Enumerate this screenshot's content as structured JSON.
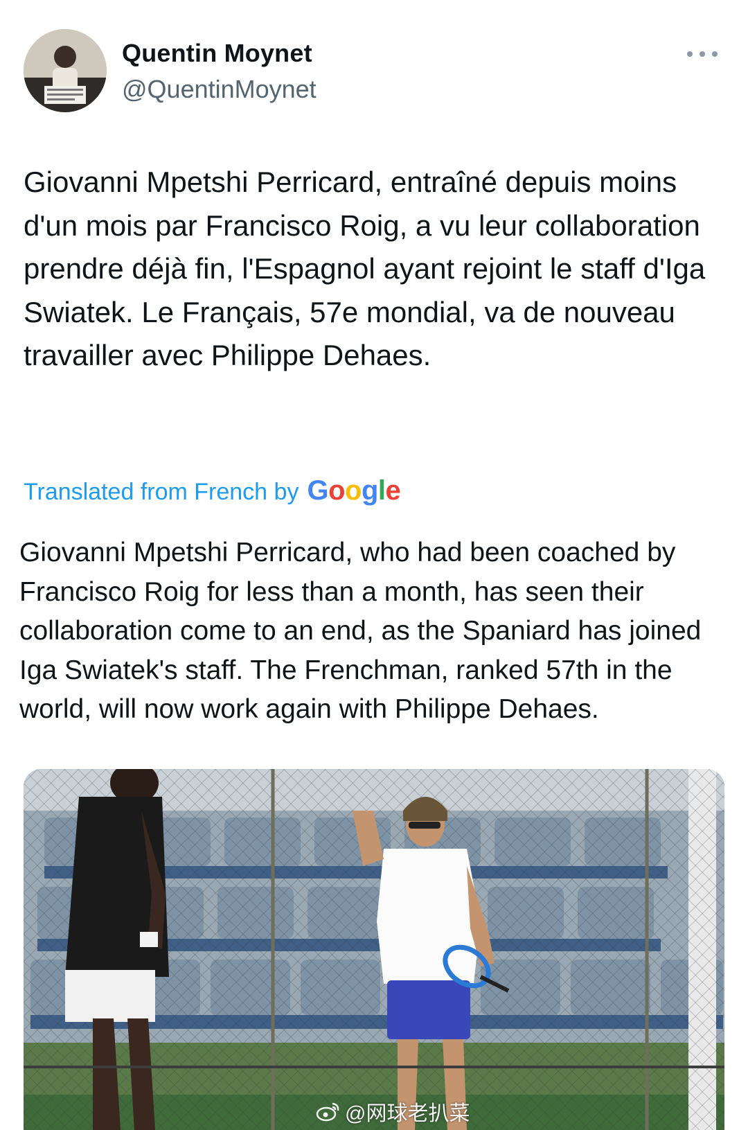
{
  "tweet": {
    "author_name": "Quentin Moynet",
    "author_handle": "@QuentinMoynet",
    "more_icon": "more-horizontal-icon",
    "text": "Giovanni Mpetshi Perricard, entraîné depuis moins d'un mois par Francisco Roig, a vu leur collaboration prendre déjà fin, l'Espagnol ayant rejoint le staff d'Iga Swiatek. Le Français, 57e mondial, va de nouveau travailler avec Philippe Dehaes.",
    "translated_label": "Translated from French by",
    "translation_provider": "Google",
    "translation": "Giovanni Mpetshi Perricard, who had been coached by Francisco Roig for less than a month, has seen their collaboration come to an end, as the Spaniard has joined Iga Swiatek's staff. The Frenchman, ranked 57th in the world, will now work again with Philippe Dehaes."
  },
  "watermark": {
    "text": "@网球老扒菜",
    "icon": "weibo-icon"
  },
  "colors": {
    "link": "#1d9bf0",
    "secondary_text": "#536471",
    "primary_text": "#0f1419"
  }
}
